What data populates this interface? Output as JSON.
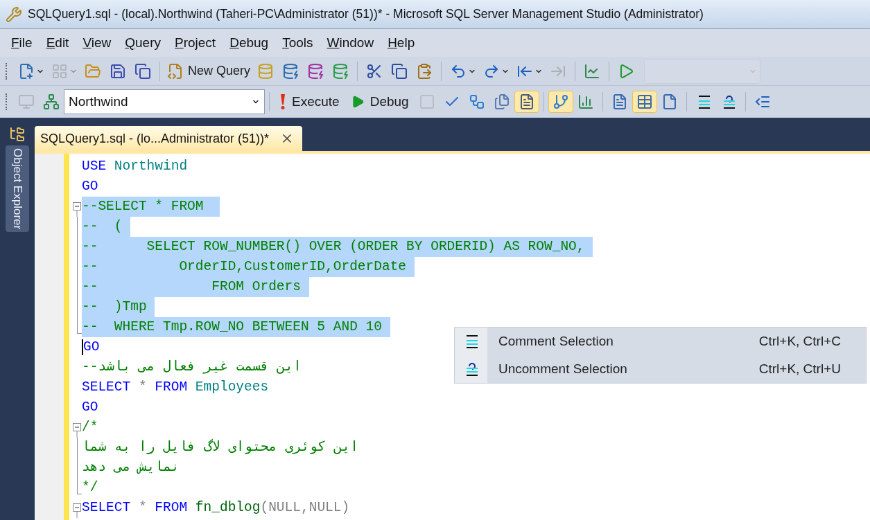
{
  "window": {
    "title": "SQLQuery1.sql - (local).Northwind (Taheri-PC\\Administrator (51))* - Microsoft SQL Server Management Studio (Administrator)"
  },
  "menu": [
    "File",
    "Edit",
    "View",
    "Query",
    "Project",
    "Debug",
    "Tools",
    "Window",
    "Help"
  ],
  "toolbar_standard": {
    "items": [
      {
        "kind": "new-project",
        "disabled": false
      },
      {
        "kind": "caret",
        "disabled": false
      },
      {
        "kind": "add-item",
        "disabled": true
      },
      {
        "kind": "caret",
        "disabled": true
      },
      {
        "kind": "open",
        "disabled": false
      },
      {
        "kind": "save",
        "disabled": false
      },
      {
        "kind": "save-all",
        "disabled": false
      },
      {
        "kind": "separator"
      },
      {
        "kind": "new-query",
        "label": "New Query",
        "disabled": false
      },
      {
        "kind": "db-query",
        "disabled": false
      },
      {
        "kind": "mdx-query",
        "disabled": false
      },
      {
        "kind": "dmx-query",
        "disabled": false
      },
      {
        "kind": "xmla-query",
        "disabled": false
      },
      {
        "kind": "separator"
      },
      {
        "kind": "cut",
        "disabled": false
      },
      {
        "kind": "copy",
        "disabled": false
      },
      {
        "kind": "paste",
        "disabled": false
      },
      {
        "kind": "separator"
      },
      {
        "kind": "undo",
        "disabled": false
      },
      {
        "kind": "caret",
        "disabled": false
      },
      {
        "kind": "redo",
        "disabled": false
      },
      {
        "kind": "caret",
        "disabled": false
      },
      {
        "kind": "nav-back",
        "disabled": false
      },
      {
        "kind": "caret",
        "disabled": false
      },
      {
        "kind": "nav-forward",
        "disabled": true
      },
      {
        "kind": "separator"
      },
      {
        "kind": "monitor",
        "disabled": false
      },
      {
        "kind": "separator"
      },
      {
        "kind": "start",
        "disabled": false
      },
      {
        "kind": "combo",
        "disabled": true
      }
    ]
  },
  "toolbar_query": {
    "items": [
      {
        "kind": "connect",
        "disabled": true,
        "pressed": false
      },
      {
        "kind": "change-connection",
        "disabled": false,
        "pressed": false
      },
      {
        "kind": "database",
        "value": "Northwind"
      },
      {
        "kind": "separator"
      },
      {
        "kind": "execute",
        "label": "Execute"
      },
      {
        "kind": "debug",
        "label": "Debug"
      },
      {
        "kind": "stop",
        "disabled": true,
        "pressed": false
      },
      {
        "kind": "parse",
        "disabled": false
      },
      {
        "kind": "design",
        "disabled": false,
        "pressed": false
      },
      {
        "kind": "specify",
        "disabled": false,
        "pressed": false
      },
      {
        "kind": "estimated-plan",
        "disabled": false,
        "pressed": true
      },
      {
        "kind": "separator"
      },
      {
        "kind": "actual-plan",
        "disabled": false,
        "pressed": true
      },
      {
        "kind": "client-stats",
        "disabled": false,
        "pressed": false
      },
      {
        "kind": "separator"
      },
      {
        "kind": "results-text",
        "disabled": false,
        "pressed": false
      },
      {
        "kind": "results-grid",
        "disabled": false,
        "pressed": true
      },
      {
        "kind": "results-file",
        "disabled": false,
        "pressed": false
      },
      {
        "kind": "separator"
      },
      {
        "kind": "comment",
        "disabled": false,
        "pressed": false
      },
      {
        "kind": "uncomment",
        "disabled": false,
        "pressed": false
      },
      {
        "kind": "separator"
      },
      {
        "kind": "outdent",
        "disabled": false,
        "pressed": false
      }
    ]
  },
  "side_panel": {
    "label": "Object Explorer"
  },
  "editor_tab": {
    "label": "SQLQuery1.sql - (lo...Administrator (51))*",
    "selected": true
  },
  "code_lines": [
    {
      "kind": "plain",
      "selected": false,
      "tokens": [
        {
          "text": "USE",
          "kind": "keyword"
        },
        {
          "text": " Northwind",
          "kind": "identifier"
        }
      ]
    },
    {
      "kind": "plain",
      "selected": false,
      "tokens": [
        {
          "text": "GO",
          "kind": "keyword"
        }
      ]
    },
    {
      "kind": "fold-start",
      "selected": true,
      "tokens": [
        {
          "text": "--SELECT * FROM ",
          "kind": "comment"
        }
      ]
    },
    {
      "kind": "fold-inner",
      "selected": true,
      "tokens": [
        {
          "text": "--  (",
          "kind": "comment"
        }
      ]
    },
    {
      "kind": "fold-inner",
      "selected": true,
      "tokens": [
        {
          "text": "--      SELECT ROW_NUMBER() OVER (ORDER BY ORDERID) AS ROW_NO,",
          "kind": "comment"
        }
      ]
    },
    {
      "kind": "fold-inner",
      "selected": true,
      "tokens": [
        {
          "text": "--          OrderID,CustomerID,OrderDate",
          "kind": "comment"
        }
      ]
    },
    {
      "kind": "fold-inner",
      "selected": true,
      "tokens": [
        {
          "text": "--              FROM Orders",
          "kind": "comment"
        }
      ]
    },
    {
      "kind": "fold-inner",
      "selected": true,
      "tokens": [
        {
          "text": "--  )Tmp",
          "kind": "comment"
        }
      ]
    },
    {
      "kind": "fold-end",
      "selected": true,
      "tokens": [
        {
          "text": "--  WHERE Tmp.ROW_NO BETWEEN 5 AND 10",
          "kind": "comment"
        }
      ]
    },
    {
      "kind": "caret-line",
      "selected": false,
      "tokens": [
        {
          "text": "GO",
          "kind": "keyword"
        }
      ]
    },
    {
      "kind": "plain",
      "selected": false,
      "tokens": [
        {
          "text": "--این قسمت غیر فعال می باشد",
          "kind": "comment"
        }
      ]
    },
    {
      "kind": "plain",
      "selected": false,
      "tokens": [
        {
          "text": "SELECT",
          "kind": "keyword"
        },
        {
          "text": " * ",
          "kind": "operator"
        },
        {
          "text": "FROM",
          "kind": "keyword"
        },
        {
          "text": " Employees",
          "kind": "identifier"
        }
      ]
    },
    {
      "kind": "plain",
      "selected": false,
      "tokens": [
        {
          "text": "GO",
          "kind": "keyword"
        }
      ]
    },
    {
      "kind": "fold-start",
      "selected": false,
      "tokens": [
        {
          "text": "/*",
          "kind": "comment"
        }
      ]
    },
    {
      "kind": "fold-inner",
      "selected": false,
      "tokens": [
        {
          "text": "این کوئری محتوای لاگ فایل را به شما",
          "kind": "comment"
        }
      ]
    },
    {
      "kind": "fold-inner",
      "selected": false,
      "tokens": [
        {
          "text": "نمایش می دهد",
          "kind": "comment"
        }
      ]
    },
    {
      "kind": "fold-end",
      "selected": false,
      "tokens": [
        {
          "text": "*/",
          "kind": "comment"
        }
      ]
    },
    {
      "kind": "fold-start",
      "selected": false,
      "tokens": [
        {
          "text": "SELECT",
          "kind": "keyword"
        },
        {
          "text": " * ",
          "kind": "operator"
        },
        {
          "text": "FROM",
          "kind": "keyword"
        },
        {
          "text": " fn_dblog",
          "kind": "function"
        },
        {
          "text": "(NULL,NULL)",
          "kind": "null"
        }
      ]
    }
  ],
  "context_menu": {
    "items": [
      {
        "label": "Comment Selection",
        "shortcut": "Ctrl+K, Ctrl+C",
        "selected": false
      },
      {
        "label": "Uncomment Selection",
        "shortcut": "Ctrl+K, Ctrl+U",
        "selected": false
      }
    ]
  }
}
